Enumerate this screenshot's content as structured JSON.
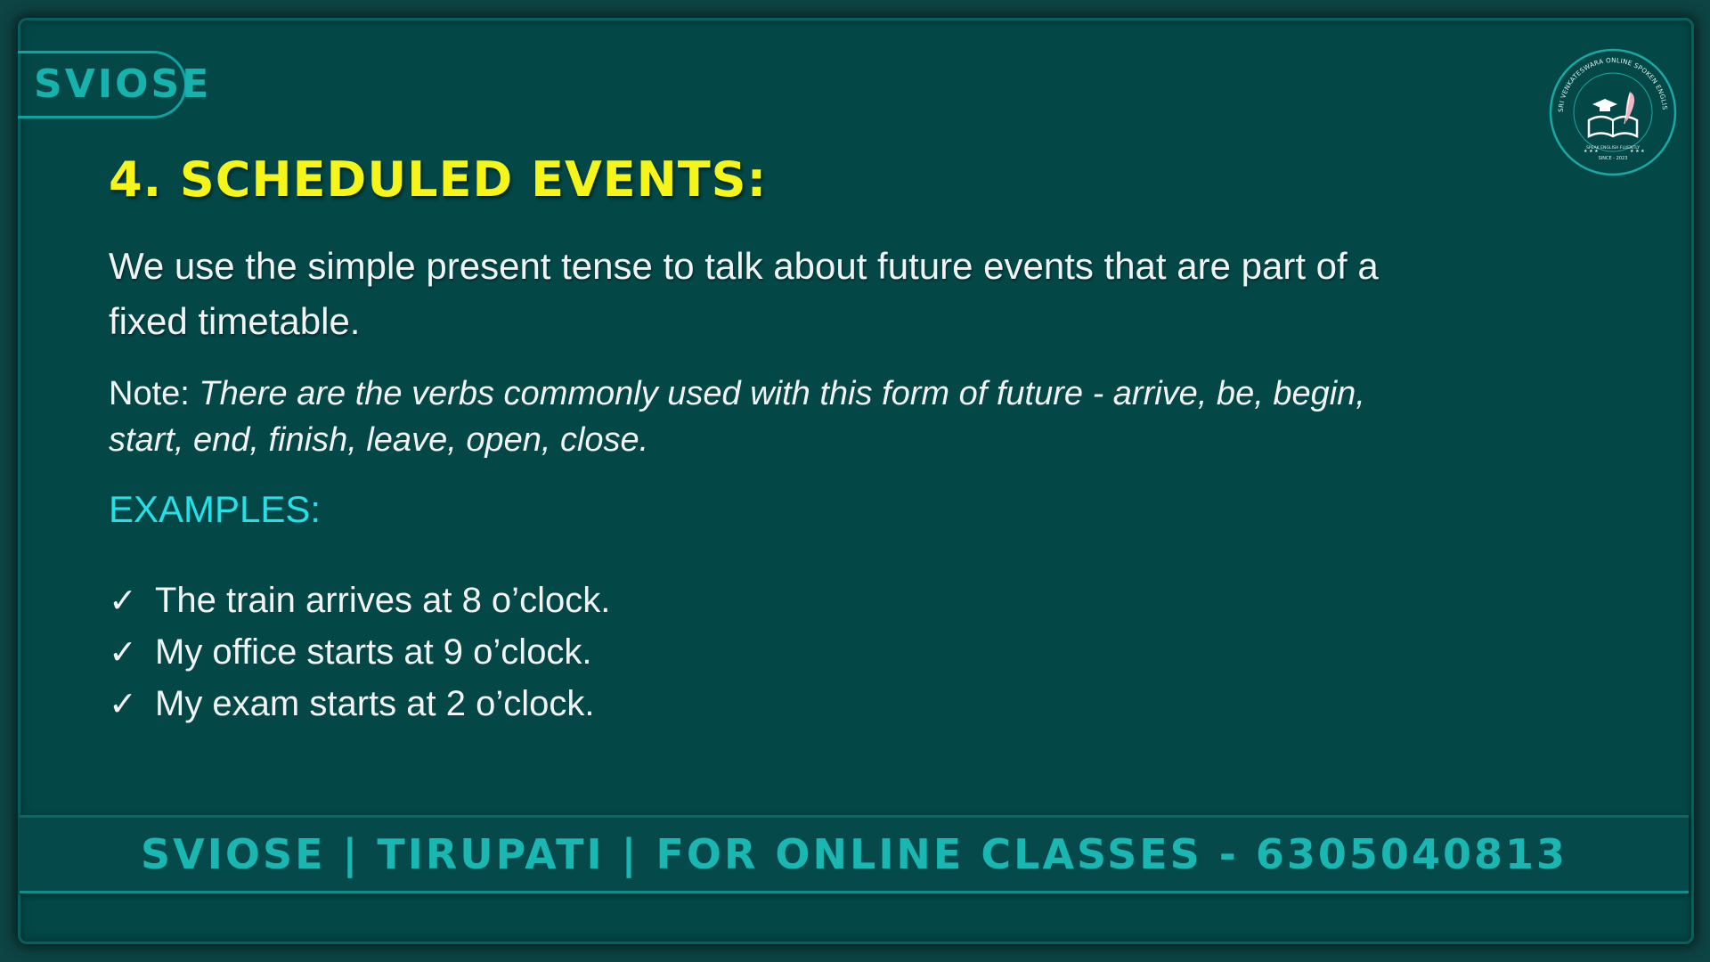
{
  "brand": {
    "tab_label": "SVIOSE"
  },
  "logo": {
    "ring_text": "SRI VENKATESWARA ONLINE SPOKEN ENGLISH SCHOOL",
    "tagline": "SPEAK ENGLISH FLUENTLY",
    "since": "SINCE - 2023",
    "icon": "book-graduation-cap-feather-icon"
  },
  "slide": {
    "heading": "4. SCHEDULED EVENTS:",
    "description": "We use the simple present tense to talk about future events that are part of a fixed timetable.",
    "note_label": "Note:",
    "note_text": "There are the verbs commonly used with this form of future - arrive, be, begin, start, end, finish, leave, open, close.",
    "examples_heading": "EXAMPLES:",
    "check_symbol": "✓",
    "examples": [
      "The train arrives at 8 o’clock.",
      "My office starts at 9 o’clock.",
      "My exam starts at 2 o’clock."
    ]
  },
  "footer": {
    "text": "SVIOSE | TIRUPATI | FOR ONLINE CLASSES - 6305040813"
  },
  "colors": {
    "background": "#034747",
    "heading": "#f5f51a",
    "accent": "#16b2ae",
    "examples_heading": "#25e0e8",
    "body_text": "#f2f4f4"
  }
}
